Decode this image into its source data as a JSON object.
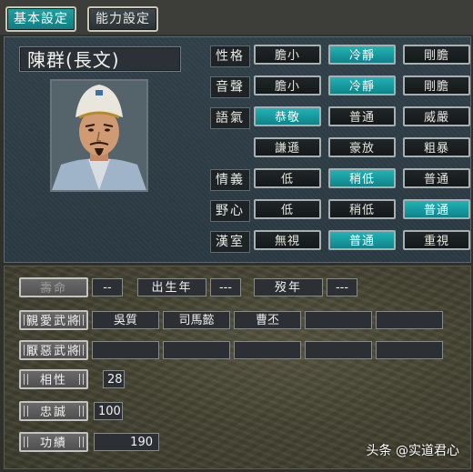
{
  "tabs": {
    "basic": "基本設定",
    "ability": "能力設定"
  },
  "officer": {
    "name": "陳群(長文)"
  },
  "traits": [
    {
      "label": "性格",
      "options": [
        "膽小",
        "冷靜",
        "剛膽"
      ],
      "selected": 1
    },
    {
      "label": "音聲",
      "options": [
        "膽小",
        "冷靜",
        "剛膽"
      ],
      "selected": 1
    },
    {
      "label": "語氣",
      "options": [
        "恭敬",
        "普通",
        "威嚴"
      ],
      "selected": 0
    },
    {
      "label": "",
      "options": [
        "謙遜",
        "豪放",
        "粗暴"
      ],
      "selected": -1
    },
    {
      "label": "情義",
      "options": [
        "低",
        "稍低",
        "普通"
      ],
      "selected": 1
    },
    {
      "label": "野心",
      "options": [
        "低",
        "稍低",
        "普通"
      ],
      "selected": 2
    },
    {
      "label": "漢室",
      "options": [
        "無視",
        "普通",
        "重視"
      ],
      "selected": 1
    }
  ],
  "lower": {
    "lifespan_label": "壽命",
    "lifespan_value": "--",
    "birth_label": "出生年",
    "birth_value": "---",
    "death_label": "歿年",
    "death_value": "---",
    "liked_label": "親愛武將",
    "liked": [
      "吳質",
      "司馬懿",
      "曹丕",
      "",
      ""
    ],
    "disliked_label": "厭惡武將",
    "disliked": [
      "",
      "",
      "",
      "",
      ""
    ],
    "compat_label": "相性",
    "compat_value": "28",
    "loyalty_label": "忠誠",
    "loyalty_value": "100",
    "merit_label": "功績",
    "merit_value": "190"
  },
  "watermark": "头条 @实道君心",
  "colors": {
    "selected": "#1a9da1",
    "unselected": "#1c2123",
    "panel": "#2f3d46"
  }
}
